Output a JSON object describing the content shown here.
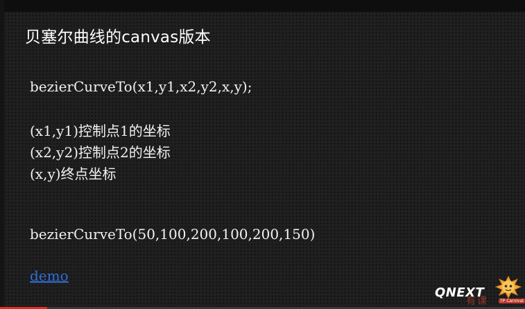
{
  "slide": {
    "title": "贝塞尔曲线的canvas版本",
    "signature": "bezierCurveTo(x1,y1,x2,y2,x,y);",
    "descriptions": [
      "(x1,y1)控制点1的坐标",
      "(x2,y2)控制点2的坐标",
      "(x,y)终点坐标"
    ],
    "example": "bezierCurveTo(50,100,200,100,200,150)",
    "demo_link": "demo"
  },
  "branding": {
    "logo_text": "QNEXT",
    "mascot_caption": "TP Carnival",
    "watermark": "有课"
  },
  "player": {
    "progress": 0.09,
    "progress_color": "#d93025"
  },
  "colors": {
    "background": "#202020",
    "text": "#f2f2f2",
    "link": "#2e6fd6"
  }
}
